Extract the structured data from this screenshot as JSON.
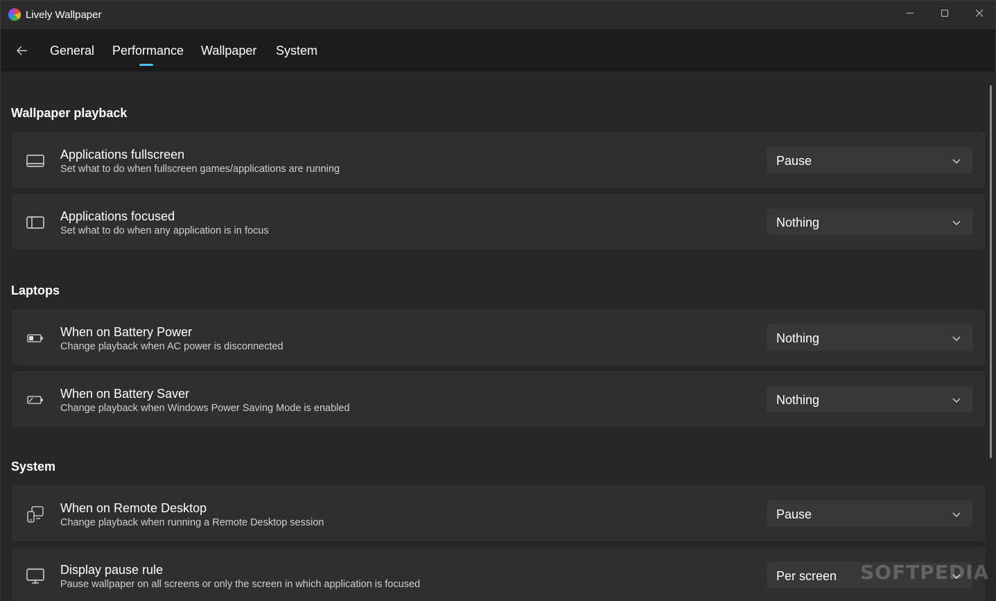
{
  "window": {
    "title": "Lively Wallpaper",
    "controls": {
      "minimize": "–",
      "maximize": "☐",
      "close": "✕"
    }
  },
  "nav": {
    "back_icon": "back-arrow-icon",
    "tabs": [
      {
        "label": "General",
        "selected": false
      },
      {
        "label": "Performance",
        "selected": true
      },
      {
        "label": "Wallpaper",
        "selected": false
      },
      {
        "label": "System",
        "selected": false
      }
    ],
    "accent_color": "#4cc2ff"
  },
  "sections": [
    {
      "title": "Wallpaper playback",
      "items": [
        {
          "icon": "fullscreen-window-icon",
          "title": "Applications fullscreen",
          "subtitle": "Set what to do when fullscreen games/applications are running",
          "value": "Pause"
        },
        {
          "icon": "focused-window-icon",
          "title": "Applications focused",
          "subtitle": "Set what to do when any application is in focus",
          "value": "Nothing"
        }
      ]
    },
    {
      "title": "Laptops",
      "items": [
        {
          "icon": "battery-icon",
          "title": "When on Battery Power",
          "subtitle": "Change playback when AC power is disconnected",
          "value": "Nothing"
        },
        {
          "icon": "battery-saver-icon",
          "title": "When on Battery Saver",
          "subtitle": "Change playback when Windows Power Saving Mode is enabled",
          "value": "Nothing"
        }
      ]
    },
    {
      "title": "System",
      "items": [
        {
          "icon": "remote-desktop-icon",
          "title": "When on Remote Desktop",
          "subtitle": "Change playback when running a Remote Desktop session",
          "value": "Pause"
        },
        {
          "icon": "monitor-icon",
          "title": "Display pause rule",
          "subtitle": "Pause wallpaper on all screens or only the screen in which application is focused",
          "value": "Per screen"
        }
      ]
    }
  ],
  "watermark": "SOFTPEDIA"
}
